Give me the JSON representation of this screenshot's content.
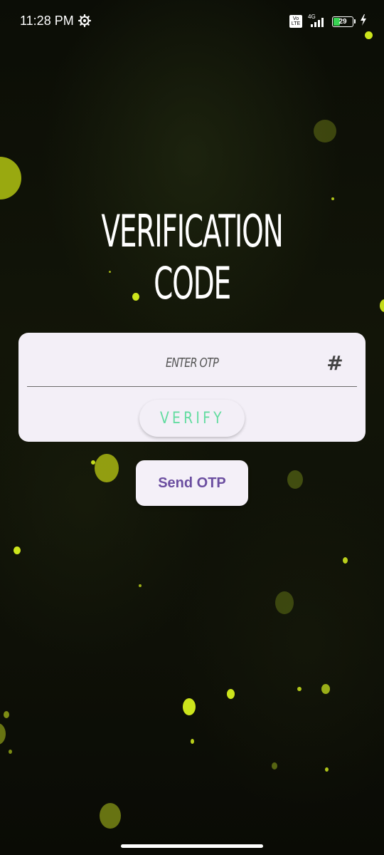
{
  "status_bar": {
    "time": "11:28 PM",
    "volte_label": "Vo LTE",
    "network_label": "4G",
    "battery_level": "29",
    "icons": [
      "gear-icon",
      "volte-icon",
      "signal-icon",
      "battery-icon",
      "charging-icon"
    ]
  },
  "screen": {
    "title": "VERIFICATION CODE"
  },
  "otp_form": {
    "placeholder": "ENTER OTP",
    "value": "",
    "trailing_icon": "#",
    "verify_label": "VERIFY"
  },
  "send_otp": {
    "label": "Send OTP"
  },
  "colors": {
    "card_background": "#f3eff7",
    "verify_text": "#63dca0",
    "send_otp_text": "#6b4ea0",
    "bokeh_dot": "#c8e61e"
  }
}
